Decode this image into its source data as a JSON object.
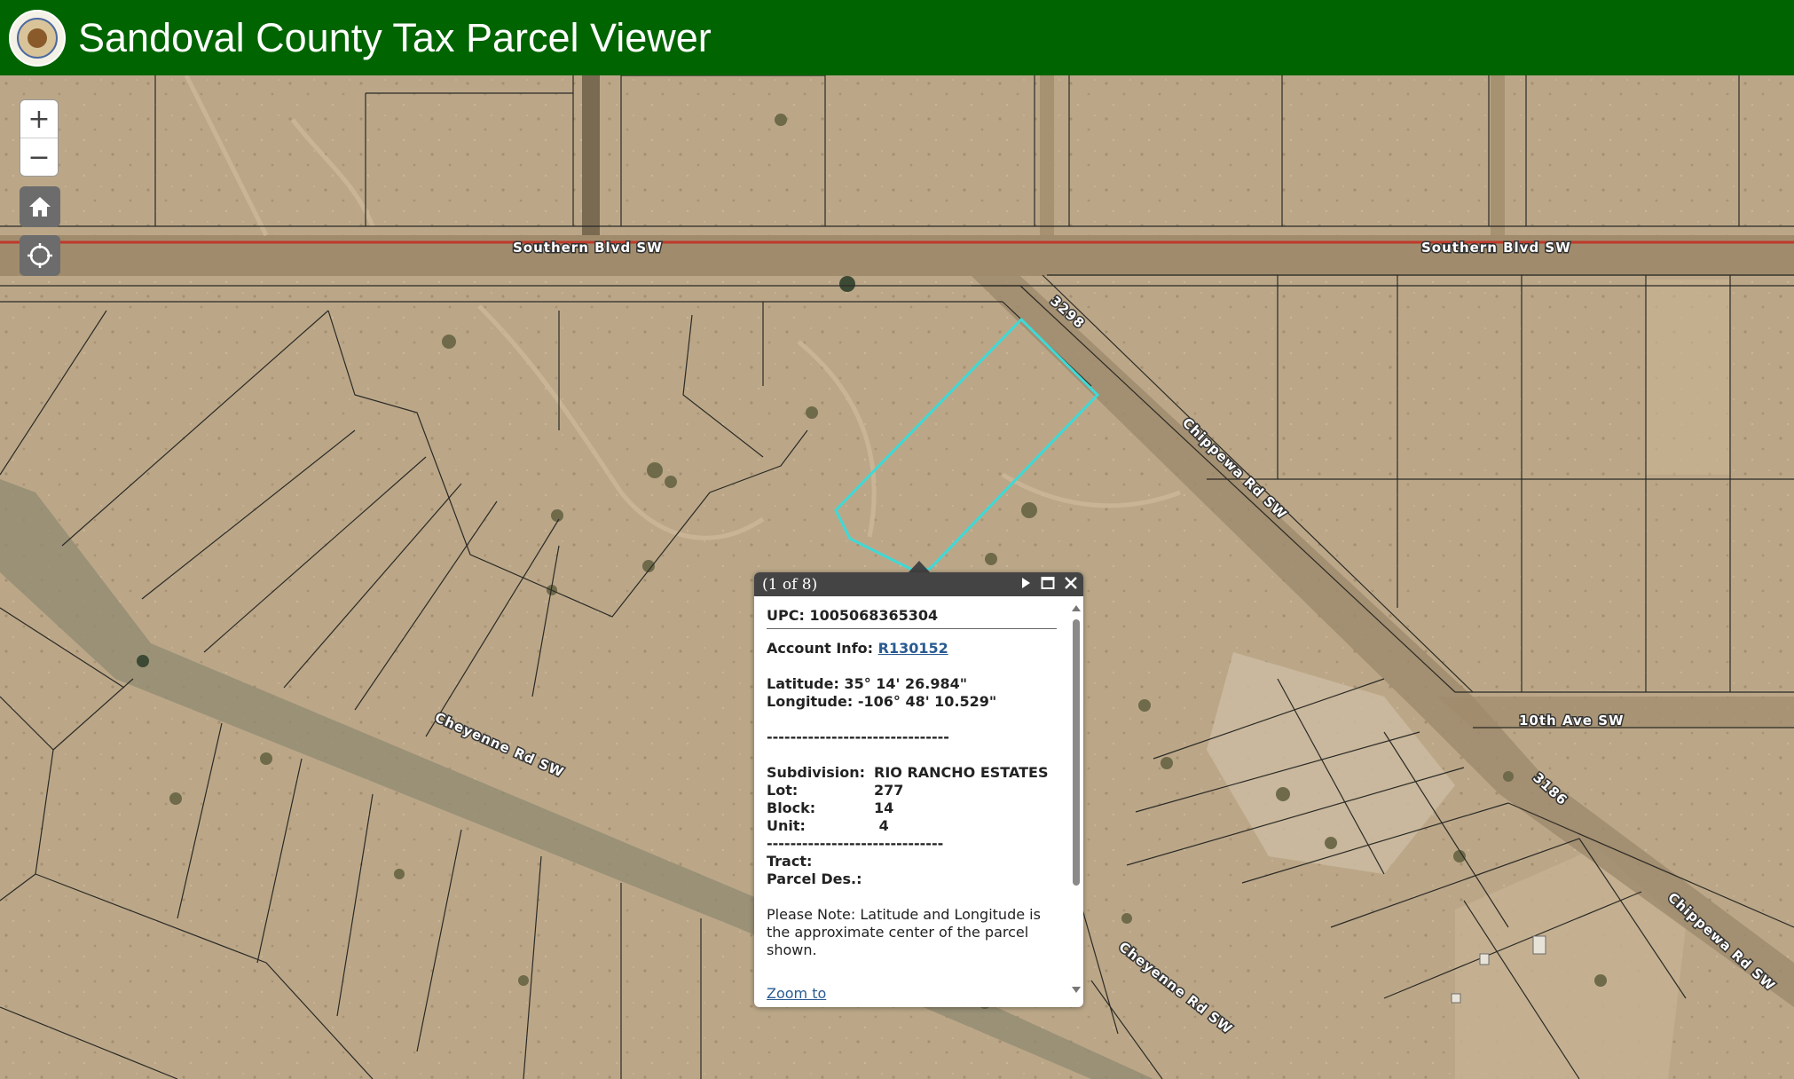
{
  "header": {
    "title": "Sandoval County Tax Parcel Viewer",
    "seal_icon": "county-seal-icon",
    "background": "#006400"
  },
  "map_controls": {
    "zoom_in": "+",
    "zoom_out": "−",
    "home_icon": "home-icon",
    "locate_icon": "locate-icon"
  },
  "map": {
    "road_labels": [
      "Southern  Blvd  SW",
      "Southern  Blvd  SW",
      "3298",
      "Chippewa  Rd  SW",
      "10th  Ave  SW",
      "3186",
      "Chippewa  Rd  SW",
      "Cheyenne  Rd  SW",
      "Cheyenne  Rd  SW"
    ],
    "selected_parcel_color": "#3fd9d6",
    "arterial_color": "#c0392b"
  },
  "popup": {
    "counter": "(1 of 8)",
    "upc_label": "UPC:",
    "upc_value": "1005068365304",
    "account_label": "Account Info:",
    "account_link": "R130152",
    "latitude": "Latitude: 35° 14' 26.984\"",
    "longitude": "Longitude: -106° 48' 10.529\"",
    "divider": "-------------------------------",
    "rows": [
      {
        "k": "Subdivision:",
        "v": "RIO RANCHO ESTATES"
      },
      {
        "k": "Lot:",
        "v": "277"
      },
      {
        "k": "Block:",
        "v": "14"
      },
      {
        "k": "Unit:",
        "v": " 4"
      }
    ],
    "divider2": "------------------------------",
    "tract_label": "Tract:",
    "parcel_des_label": "Parcel Des.:",
    "note": "Please Note: Latitude and Longitude is the approximate center of the parcel shown.",
    "zoom_to": "Zoom to"
  }
}
